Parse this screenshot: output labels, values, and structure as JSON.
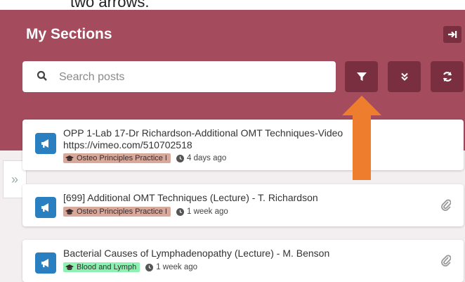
{
  "top_text": "two arrows.",
  "header": {
    "title": "My Sections"
  },
  "search": {
    "placeholder": "Search posts"
  },
  "toolbar": {
    "filter": "filter-icon",
    "collapse_all": "double-chevron-down-icon",
    "refresh": "refresh-icon"
  },
  "posts": [
    {
      "title": "OPP 1-Lab 17-Dr Richardson-Additional OMT Techniques-Video https://vimeo.com/510702518",
      "tag": "Osteo Principles Practice I",
      "tag_color": "#d8a99a",
      "time": "4 days ago",
      "attachment": false
    },
    {
      "title": "[699] Additional OMT Techniques (Lecture) - T. Richardson",
      "tag": "Osteo Principles Practice I",
      "tag_color": "#d8a99a",
      "time": "1 week ago",
      "attachment": true
    },
    {
      "title": "Bacterial Causes of Lymphadenopathy (Lecture) - M. Benson",
      "tag": "Blood and Lymph",
      "tag_color": "#8ff0b4",
      "time": "1 week ago",
      "attachment": true
    }
  ],
  "colors": {
    "header": "#a44b5d",
    "button": "#7a2f40",
    "post_icon": "#2a7fc0",
    "arrow": "#ef7d2e"
  }
}
